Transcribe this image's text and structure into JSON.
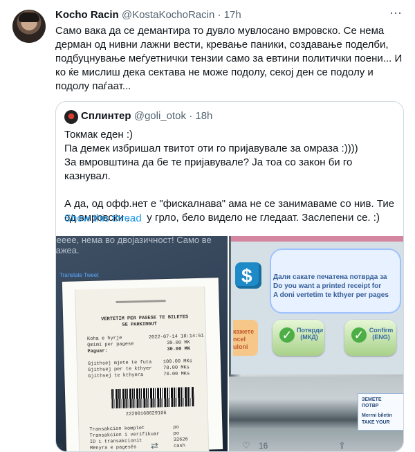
{
  "tweet": {
    "name": "Kocho Racin",
    "handle": "@KostaKochoRacin",
    "separator": "·",
    "time": "17h",
    "text": "Само вака да се демантира то дувло мувлосано вмровско. Се нема дерман од нивни лажни вести, кревање паники, создавање поделби, подбуцнување меѓуетнички тензии само за евтини политички поени... И ко ќе мислиш дека сектава не може подолу, секој ден се подолу и подолу паѓаат..."
  },
  "quote": {
    "name": "Сплинтер",
    "handle": "@goli_otok",
    "separator": "·",
    "time": "18h",
    "text": "Токмак еден :)\nПа демек избришал твитот оти го пријавувале за омраза :))))\nЗа вмровштина да бе те пријавувале? Ја тоа со закон би го казнувал.\n\nА да, од офф.нет е \"фискалнава\" ама не се занимаваме со нив. Тие\nод вмровски ...    у грло, бело видело не гледаат. Заслепени се. :)",
    "show_thread": "Show this thread"
  },
  "media": {
    "left_overlay": "Еееее, нема во двојазичност! Само ве лажеа.",
    "translate": "Translate Tweet",
    "receipt": {
      "title_1": "VERTETIM PER PAGESE TE BILETES",
      "title_2": "SE PARKINGUT",
      "entry": "Koha e hyrje",
      "entry_value": "2022-07-14 18:14:51",
      "amount_label": "Qmimi per pagese",
      "amount_value": "30.00 MK",
      "paid_label": "Paguar:",
      "paid_value": "30.00 MK",
      "total_1": "Gjithsej mjete te futa",
      "total_1_value": "100.00 MKs",
      "total_2": "Gjithsej per te kthyer",
      "total_2_value": "70.00 MKs",
      "total_3": "Gjithsej te kthyera",
      "total_3_value": "70.00 MKs",
      "barcode_number": "22200168629106",
      "tx_1": "Transakcion komplet",
      "tx_1_value": "po",
      "tx_2": "Transakcion i verifikuar",
      "tx_2_value": "po",
      "tx_3": "ID i transakcionit",
      "tx_3_value": "32626",
      "tx_4": "Mënyra e pagesës",
      "tx_4_value": "cash"
    },
    "kiosk": {
      "line_1": "Дали сакате печатена потврда за",
      "line_2": "Do you want a printed receipt for",
      "line_3": "A doni vertetim te kthyer per pages",
      "side_1": "кажете",
      "side_2": "ncel",
      "side_3": "uloni",
      "button_1": "Потврди (МКД)",
      "button_2": "Confirm (ENG)",
      "sticker_1": "ЗЕМЕТЕ",
      "sticker_2": "ПОТВР",
      "sticker_3": "Merrni biletin",
      "sticker_4": "TAKE YOUR"
    }
  },
  "actions": {
    "reply_count": "",
    "retweet_count": "",
    "like_count": "16"
  },
  "colors": {
    "text": "#0f1419",
    "muted": "#536471",
    "link": "#1d9bf0",
    "border": "#cfd9de"
  }
}
